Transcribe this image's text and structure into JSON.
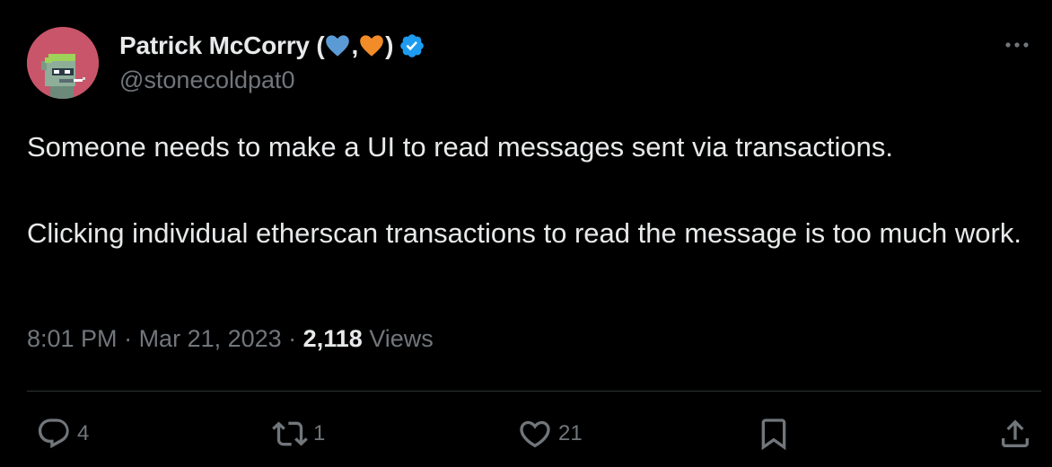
{
  "author": {
    "name_prefix": "Patrick McCorry (",
    "name_sep": ",",
    "name_suffix": ")",
    "handle": "@stonecoldpat0",
    "verified_color": "#1d9bf0",
    "avatar_bg": "#c8556a"
  },
  "hearts": {
    "first_color": "#5b9bd5",
    "second_color": "#f28c28"
  },
  "tweet": {
    "line1": "Someone needs to make a UI to read messages sent via transactions.",
    "line2": "Clicking individual etherscan transactions to read the message is too much work."
  },
  "meta": {
    "time": "8:01 PM",
    "sep1": " · ",
    "date": "Mar 21, 2023",
    "sep2": " · ",
    "views_count": "2,118",
    "views_label": " Views"
  },
  "actions": {
    "replies": "4",
    "retweets": "1",
    "likes": "21"
  },
  "icons": [
    "more-icon",
    "reply-icon",
    "retweet-icon",
    "like-icon",
    "bookmark-icon",
    "share-icon",
    "verified-badge-icon",
    "heart-icon"
  ]
}
